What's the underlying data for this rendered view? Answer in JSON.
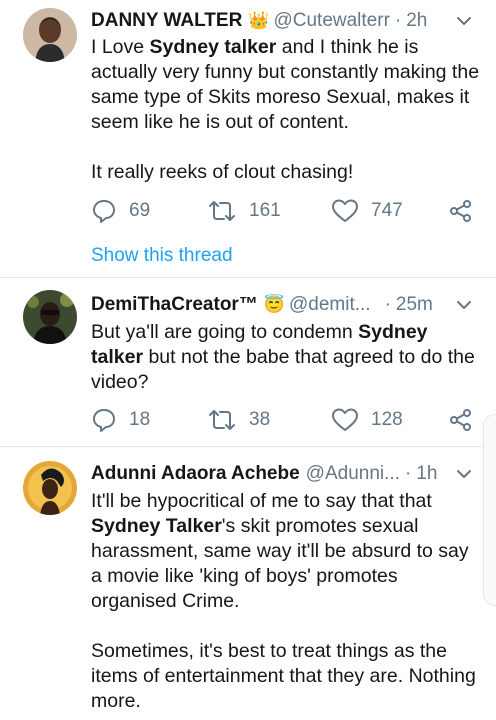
{
  "tweets": [
    {
      "name": "DANNY WALTER",
      "badge": "👑",
      "handle": "@Cutewalterr",
      "separator": "·",
      "time": "2h",
      "body": {
        "line1": {
          "pre": "I Love ",
          "bold": "Sydney talker",
          "post": " and I think he is actually very funny but constantly making the same type of Skits moreso Sexual, makes it seem like he is out of content."
        },
        "line2": "It really reeks of clout chasing!"
      },
      "replies": "69",
      "retweets": "161",
      "likes": "747",
      "thread_link": "Show this thread"
    },
    {
      "name": "DemiThaCreator™",
      "badge": "😇",
      "handle": "@demit...",
      "separator": "·",
      "time": "25m",
      "body": {
        "line1": {
          "pre": "But ya'll are going to condemn ",
          "bold": "Sydney talker",
          "post": " but not the babe that agreed to do the video?"
        }
      },
      "replies": "18",
      "retweets": "38",
      "likes": "128"
    },
    {
      "name": "Adunni Adaora Achebe",
      "handle": "@Adunni...",
      "separator": "·",
      "time": "1h",
      "body": {
        "line1": {
          "pre": "It'll be hypocritical of me to say that that ",
          "bold": "Sydney Talker",
          "post": "'s skit promotes sexual harassment, same way it'll be absurd to say a movie like 'king of boys' promotes organised Crime."
        },
        "line2": "Sometimes, it's best to treat things as the items of entertainment that they are. Nothing more."
      }
    }
  ],
  "icons": {
    "reply": "reply-icon",
    "retweet": "retweet-icon",
    "like": "heart-icon",
    "share": "share-icon",
    "more": "chevron-down-icon"
  },
  "colors": {
    "text": "#14171a",
    "muted": "#657786",
    "link": "#1da1f2",
    "divider": "#e1e8ed"
  }
}
